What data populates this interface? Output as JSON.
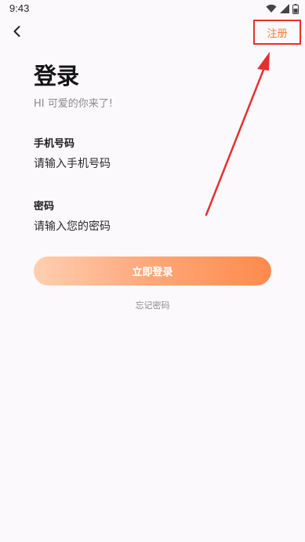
{
  "status_bar": {
    "time": "9:43",
    "icons": [
      "wifi-icon",
      "cellular-signal-icon",
      "battery-icon"
    ]
  },
  "nav": {
    "back_icon": "chevron-left-icon",
    "register_label": "注册"
  },
  "login": {
    "title": "登录",
    "subtitle": "HI 可爱的你来了!",
    "phone_label": "手机号码",
    "phone_placeholder": "请输入手机号码",
    "password_label": "密码",
    "password_placeholder": "请输入您的密码",
    "submit_label": "立即登录",
    "forgot_label": "忘记密码"
  },
  "colors": {
    "accent": "#f07a38",
    "highlight": "#e53030",
    "button_gradient_start": "#ffcfb0",
    "button_gradient_end": "#ff8a4c"
  }
}
